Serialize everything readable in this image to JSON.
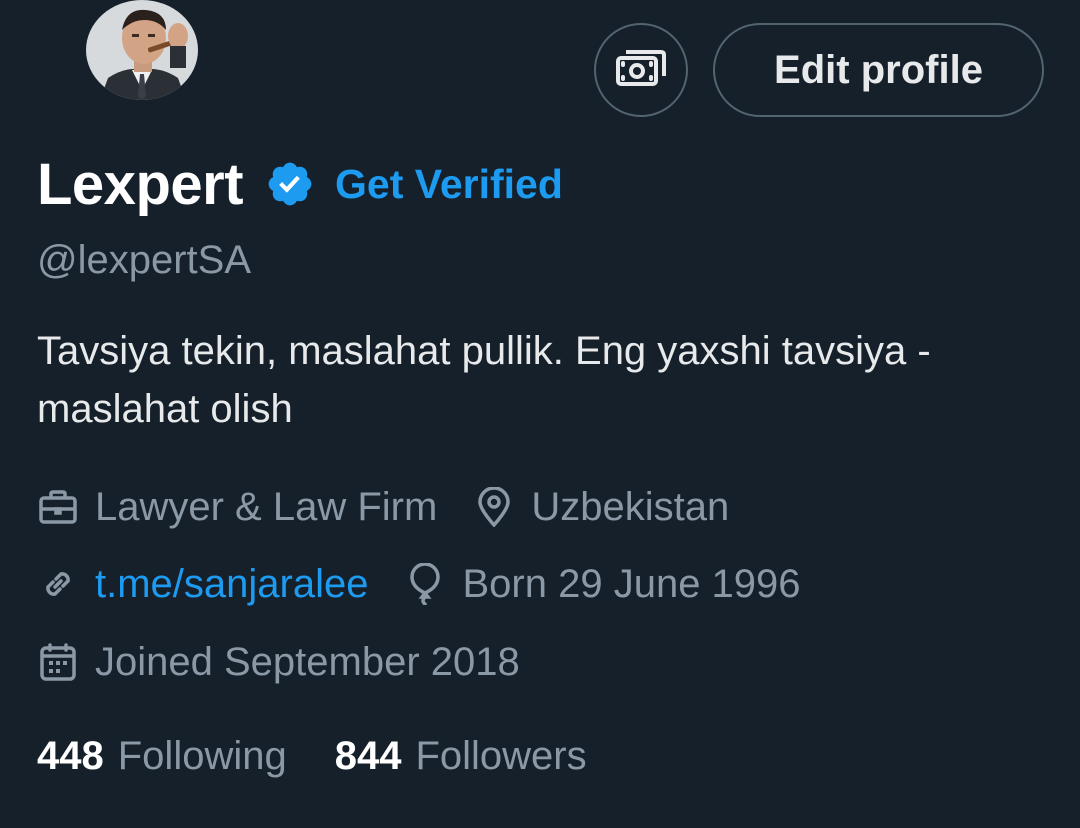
{
  "profile": {
    "display_name": "Lexpert",
    "handle": "@lexpertSA",
    "verified_badge_color": "#1d9bf0",
    "get_verified_label": "Get Verified",
    "bio": "Tavsiya tekin, maslahat pullik. Eng yaxshi tavsiya - maslahat olish"
  },
  "actions": {
    "tip_icon": "money-icon",
    "edit_profile_label": "Edit profile"
  },
  "meta": {
    "category": "Lawyer & Law Firm",
    "location": "Uzbekistan",
    "website": "t.me/sanjaralee",
    "birthday": "Born 29 June 1996",
    "joined": "Joined September 2018"
  },
  "stats": {
    "following_count": "448",
    "following_label": "Following",
    "followers_count": "844",
    "followers_label": "Followers"
  },
  "colors": {
    "background": "#15202b",
    "accent": "#1d9bf0",
    "muted": "#8b98a5",
    "border": "#536471"
  }
}
